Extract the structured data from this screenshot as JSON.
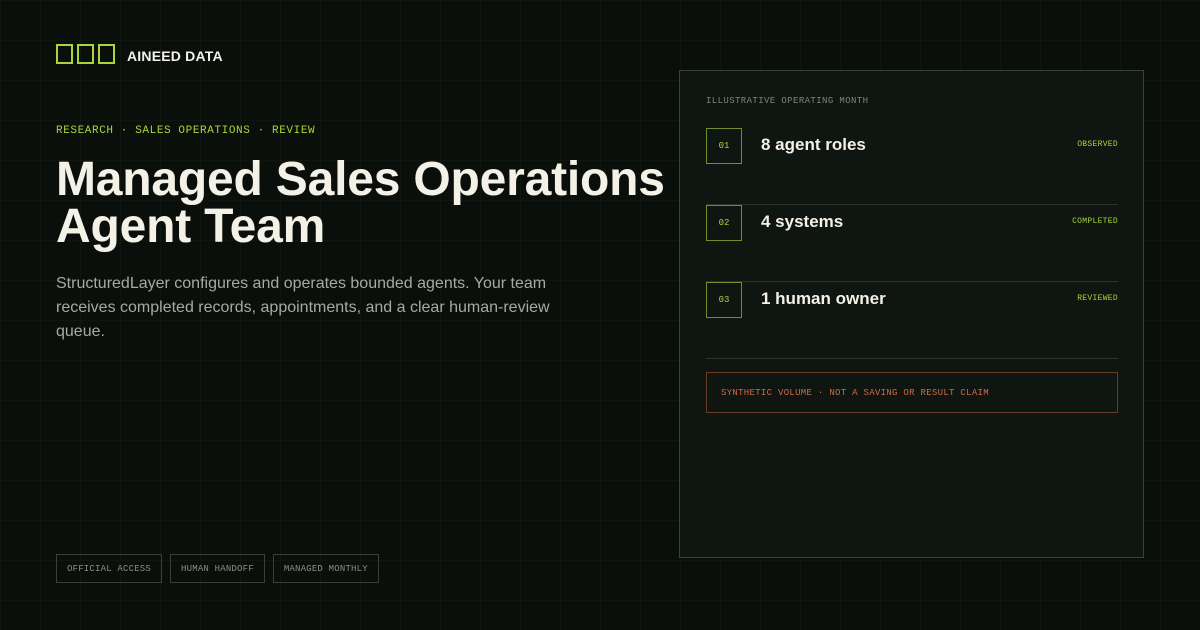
{
  "brand": {
    "name": "AINEED DATA",
    "mark_color": "#a9d63a"
  },
  "eyebrow": "RESEARCH · SALES OPERATIONS · REVIEW",
  "title": "Managed Sales Operations Agent Team",
  "subtitle": "StructuredLayer configures and operates bounded agents. Your team receives completed records, appointments, and a clear human-review queue.",
  "tags": [
    "OFFICIAL ACCESS",
    "HUMAN HANDOFF",
    "MANAGED MONTHLY"
  ],
  "panel": {
    "title": "ILLUSTRATIVE OPERATING MONTH",
    "metrics": [
      {
        "num": "01",
        "label": "8 agent roles",
        "status": "OBSERVED"
      },
      {
        "num": "02",
        "label": "4 systems",
        "status": "COMPLETED"
      },
      {
        "num": "03",
        "label": "1 human owner",
        "status": "REVIEWED"
      }
    ],
    "disclaimer": "SYNTHETIC VOLUME · NOT A SAVING OR RESULT CLAIM"
  },
  "colors": {
    "accent": "#a9d63a",
    "warning": "#d0694a",
    "background": "#0a0f0b"
  }
}
